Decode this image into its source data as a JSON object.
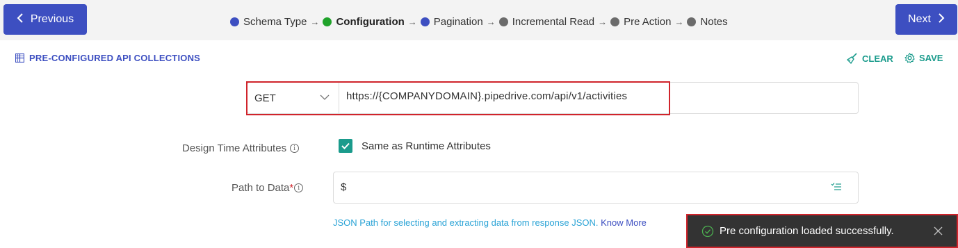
{
  "nav": {
    "previous_label": "Previous",
    "next_label": "Next"
  },
  "steps": [
    {
      "label": "Schema Type",
      "color": "#3d4fc1",
      "active": false
    },
    {
      "label": "Configuration",
      "color": "#1fa22a",
      "active": true
    },
    {
      "label": "Pagination",
      "color": "#3d4fc1",
      "active": false
    },
    {
      "label": "Incremental Read",
      "color": "#6b6b6b",
      "active": false
    },
    {
      "label": "Pre Action",
      "color": "#6b6b6b",
      "active": false
    },
    {
      "label": "Notes",
      "color": "#6b6b6b",
      "active": false
    }
  ],
  "step_separator": "→",
  "toolbar": {
    "collections_label": "PRE-CONFIGURED API COLLECTIONS",
    "clear_label": "CLEAR",
    "save_label": "SAVE"
  },
  "request": {
    "method": "GET",
    "url": "https://{COMPANYDOMAIN}.pipedrive.com/api/v1/activities"
  },
  "design_time": {
    "label": "Design Time Attributes",
    "checkbox_label": "Same as Runtime Attributes",
    "checked": true
  },
  "path_to_data": {
    "label": "Path to Data",
    "required_mark": "*",
    "value": "$",
    "hint": "JSON Path for selecting and extracting data from response JSON.",
    "hint_link": "Know More"
  },
  "toast": {
    "message": "Pre configuration loaded successfully."
  },
  "colors": {
    "primary": "#3d4fc1",
    "accent": "#1a9b8c",
    "highlight": "#d0242b",
    "toast_bg": "#333333"
  }
}
